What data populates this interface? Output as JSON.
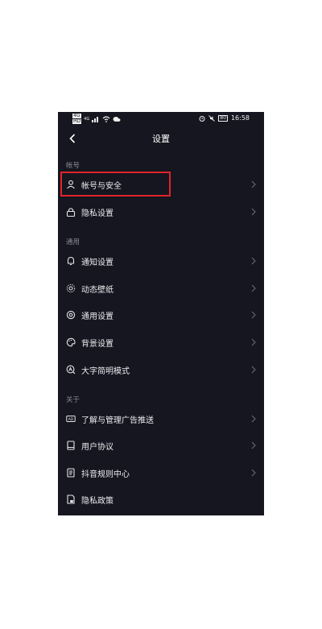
{
  "status_bar": {
    "network_badge": "4G",
    "network_badge2": "HD",
    "signal_label": "4G",
    "battery": "80",
    "time": "16:58"
  },
  "header": {
    "title": "设置"
  },
  "sections": [
    {
      "title": "帐号",
      "items": [
        {
          "label": "帐号与安全",
          "icon": "user-icon"
        },
        {
          "label": "隐私设置",
          "icon": "lock-icon"
        }
      ]
    },
    {
      "title": "通用",
      "items": [
        {
          "label": "通知设置",
          "icon": "bell-icon"
        },
        {
          "label": "动态壁纸",
          "icon": "wallpaper-icon"
        },
        {
          "label": "通用设置",
          "icon": "gear-icon"
        },
        {
          "label": "背景设置",
          "icon": "palette-icon"
        },
        {
          "label": "大字简明模式",
          "icon": "large-text-icon"
        }
      ]
    },
    {
      "title": "关于",
      "items": [
        {
          "label": "了解与管理广告推送",
          "icon": "ad-icon"
        },
        {
          "label": "用户协议",
          "icon": "book-icon"
        },
        {
          "label": "抖音规则中心",
          "icon": "rules-icon"
        },
        {
          "label": "隐私政策",
          "icon": "privacy-doc-icon"
        }
      ]
    }
  ],
  "highlight_color": "#e0242b"
}
